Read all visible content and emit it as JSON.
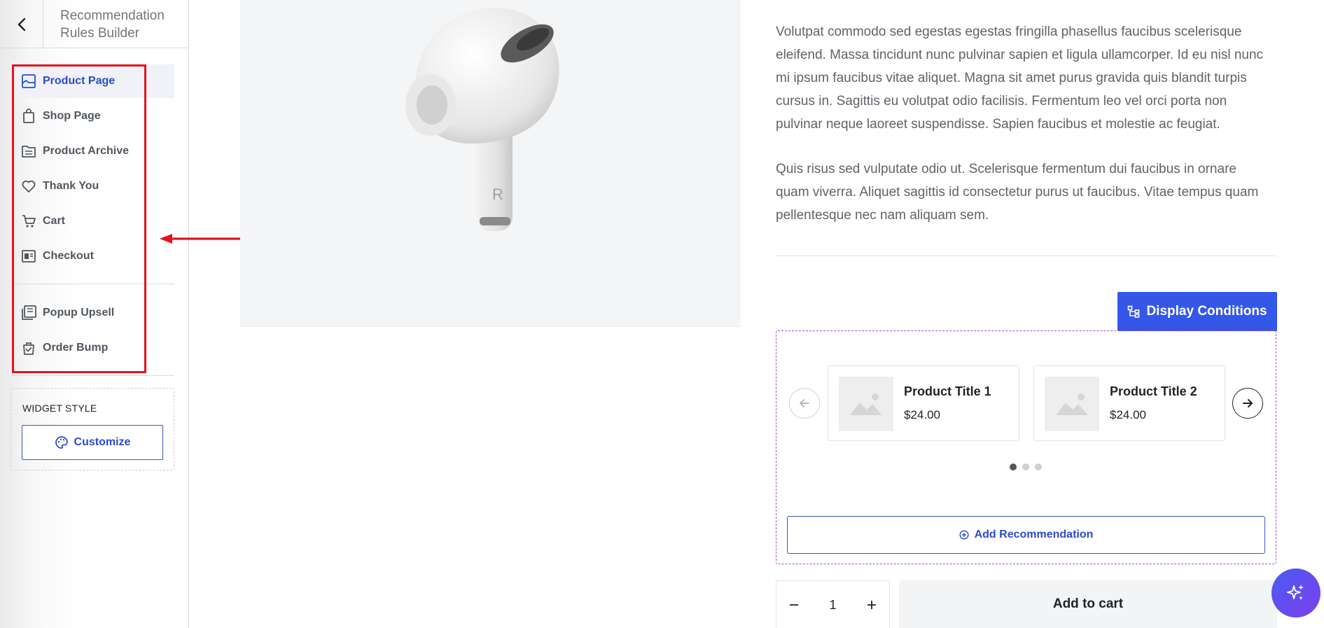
{
  "header": {
    "title": "Recommendation Rules Builder"
  },
  "sidebar": {
    "items": [
      {
        "label": "Product Page",
        "icon": "product-page-icon",
        "active": true
      },
      {
        "label": "Shop Page",
        "icon": "shopping-bag-icon"
      },
      {
        "label": "Product Archive",
        "icon": "archive-icon"
      },
      {
        "label": "Thank You",
        "icon": "heart-icon"
      },
      {
        "label": "Cart",
        "icon": "cart-icon"
      },
      {
        "label": "Checkout",
        "icon": "checkout-icon"
      },
      {
        "label": "Popup Upsell",
        "icon": "popup-icon"
      },
      {
        "label": "Order Bump",
        "icon": "order-bump-icon"
      }
    ],
    "widget_style": {
      "label": "WIDGET STYLE",
      "customize_label": "Customize"
    }
  },
  "content": {
    "paragraph1": "Volutpat commodo sed egestas egestas fringilla phasellus faucibus scelerisque eleifend. Massa tincidunt nunc pulvinar sapien et ligula ullamcorper. Id eu nisl nunc mi ipsum faucibus vitae aliquet. Magna sit amet purus gravida quis blandit turpis cursus in. Sagittis eu volutpat odio facilisis. Fermentum leo vel orci porta non pulvinar neque laoreet suspendisse. Sapien faucibus et molestie ac feugiat.",
    "paragraph2": "Quis risus sed vulputate odio ut. Scelerisque fermentum dui faucibus in ornare quam viverra. Aliquet sagittis id consectetur purus ut faucibus. Vitae tempus quam pellentesque nec nam aliquam sem."
  },
  "recommendation": {
    "display_conditions_label": "Display Conditions",
    "products": [
      {
        "title": "Product Title 1",
        "price": "$24.00"
      },
      {
        "title": "Product Title 2",
        "price": "$24.00"
      }
    ],
    "carousel_pages": 3,
    "active_page": 1,
    "add_label": "Add Recommendation"
  },
  "cart": {
    "quantity": "1",
    "add_to_cart_label": "Add to cart"
  },
  "colors": {
    "accent": "#3557e8",
    "annotation": "#e3131b",
    "dashed_border": "#a44cc8"
  }
}
